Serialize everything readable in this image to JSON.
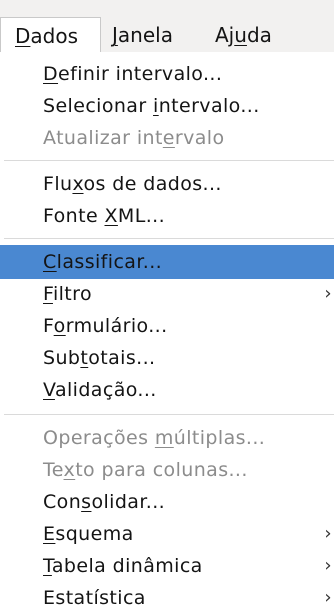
{
  "menubar": [
    {
      "pre": "",
      "ul": "D",
      "post": "ados"
    },
    {
      "pre": "",
      "ul": "J",
      "post": "anela"
    },
    {
      "pre": "Aj",
      "ul": "u",
      "post": "da"
    }
  ],
  "menu": [
    {
      "pre": "",
      "ul": "D",
      "post": "efinir intervalo...",
      "disabled": false
    },
    {
      "pre": "Selecionar ",
      "ul": "i",
      "post": "ntervalo...",
      "disabled": false
    },
    {
      "pre": "Atualizar int",
      "ul": "e",
      "post": "rvalo",
      "disabled": true
    },
    {
      "pre": "Flu",
      "ul": "x",
      "post": "os de dados...",
      "disabled": false
    },
    {
      "pre": "Fonte ",
      "ul": "X",
      "post": "ML...",
      "disabled": false
    },
    {
      "pre": "",
      "ul": "C",
      "post": "lassificar...",
      "disabled": false,
      "highlight": true
    },
    {
      "pre": "",
      "ul": "F",
      "post": "iltro",
      "disabled": false,
      "submenu": "›"
    },
    {
      "pre": "F",
      "ul": "o",
      "post": "rmulário...",
      "disabled": false
    },
    {
      "pre": "Sub",
      "ul": "t",
      "post": "otais...",
      "disabled": false
    },
    {
      "pre": "",
      "ul": "V",
      "post": "alidação...",
      "disabled": false
    },
    {
      "pre": "Operações ",
      "ul": "m",
      "post": "últiplas...",
      "disabled": true
    },
    {
      "pre": "Te",
      "ul": "x",
      "post": "to para colunas...",
      "disabled": true
    },
    {
      "pre": "Con",
      "ul": "s",
      "post": "olidar...",
      "disabled": false
    },
    {
      "pre": "",
      "ul": "E",
      "post": "squema",
      "disabled": false,
      "submenu": "›"
    },
    {
      "pre": "",
      "ul": "T",
      "post": "abela dinâmica",
      "disabled": false,
      "submenu": "›"
    },
    {
      "pre": "Estatística",
      "ul": "",
      "post": "",
      "disabled": false,
      "submenu": "›"
    }
  ],
  "colors": {
    "highlight": "#4a88d1",
    "disabled": "#8c8c8c",
    "menubar_bg": "#f2f1f0"
  }
}
